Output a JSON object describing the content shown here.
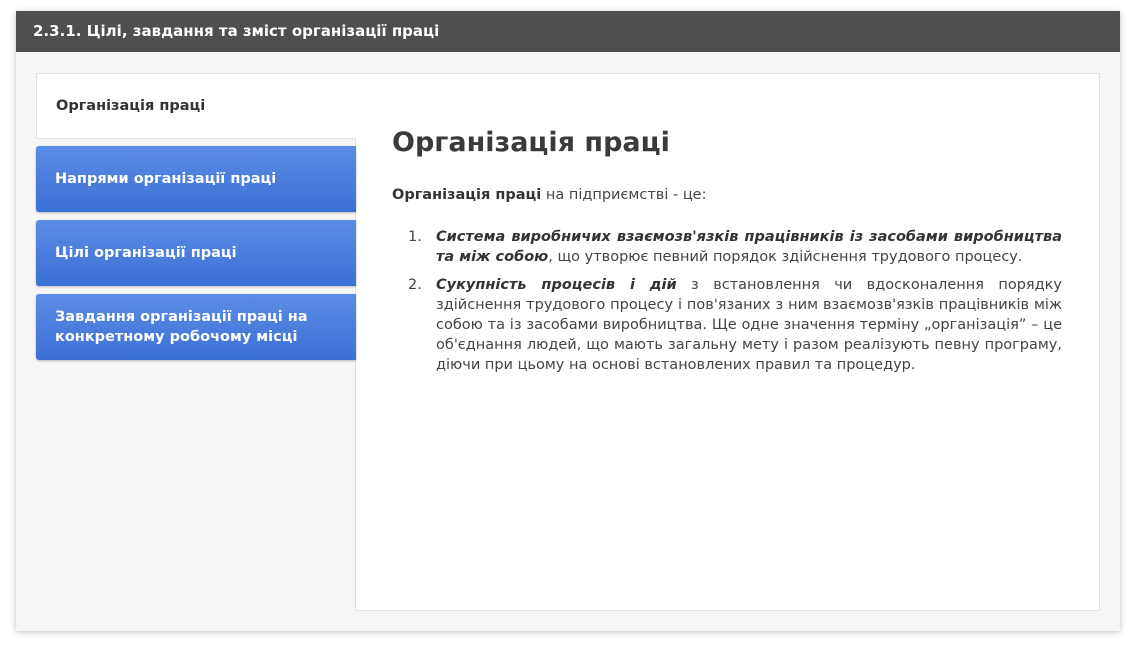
{
  "header": {
    "title": "2.3.1. Цілі, завдання та зміст організації праці"
  },
  "tabs": [
    {
      "label": "Організація праці",
      "active": true
    },
    {
      "label": "Напрями організації праці",
      "active": false
    },
    {
      "label": "Цілі організації праці",
      "active": false
    },
    {
      "label": "Завдання організації праці на конкретному робочому місці",
      "active": false
    }
  ],
  "content": {
    "heading": "Організація праці",
    "intro_bold": "Організація праці",
    "intro_rest": " на підприємстві - це:",
    "items": [
      {
        "number": "1.",
        "bold_italic": "Система виробничих взаємозв'язків працівників із засобами виробництва та між собою",
        "text": ", що утворює певний порядок здійснення трудового процесу."
      },
      {
        "number": "2.",
        "bold_italic": "Сукупність процесів і дій",
        "text": " з встановлення чи вдосконалення порядку здійснення трудового процесу і пов'язаних з ним взаємозв'язків працівників між собою та із засобами виробництва. Ще одне значення терміну „організація” – це об'єднання людей, що мають загальну мету і разом реалізують певну програму, діючи при цьому на основі встановлених правил та процедур."
      }
    ]
  },
  "colors": {
    "titlebar": "#4f4f4f",
    "tab_blue": "#4a7fdc",
    "background": "#f6f6f6"
  }
}
